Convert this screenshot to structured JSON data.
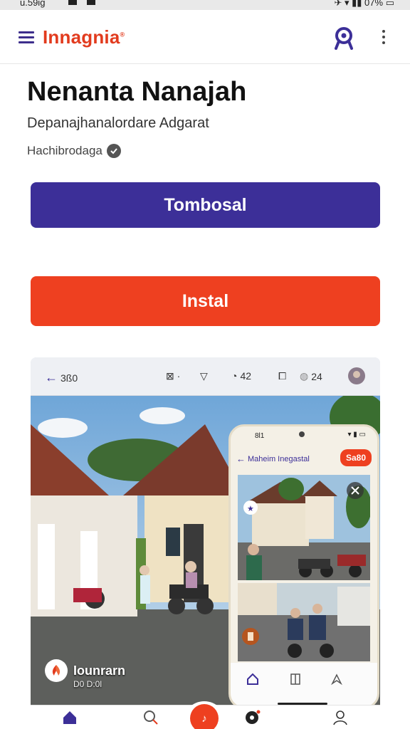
{
  "status": {
    "time": "u.59ig",
    "battery": "07%"
  },
  "appbar": {
    "brand": "Innagnia",
    "brand_mark": "®",
    "user_icon": "user-profile-icon",
    "more_icon": "more-vertical-icon"
  },
  "app": {
    "title": "Nenanta Nanajah",
    "subtitle": "Depanajhanalordare Adgarat",
    "developer": "Hachibrodaga"
  },
  "buttons": {
    "primary_label": "Tombosal",
    "install_label": "Instal"
  },
  "screenshot": {
    "toolbar": {
      "back_count": "3ß0",
      "chat_count": "42",
      "share_count": "24"
    },
    "place": {
      "name": "Iounrarn",
      "sub": "D0 D:0l"
    },
    "phone": {
      "time": "8l1",
      "title": "Maheim Inegastal",
      "badge": "Sa80"
    }
  },
  "colors": {
    "brand": "#e23b1e",
    "primary": "#3c2f98",
    "install": "#ee4020"
  }
}
